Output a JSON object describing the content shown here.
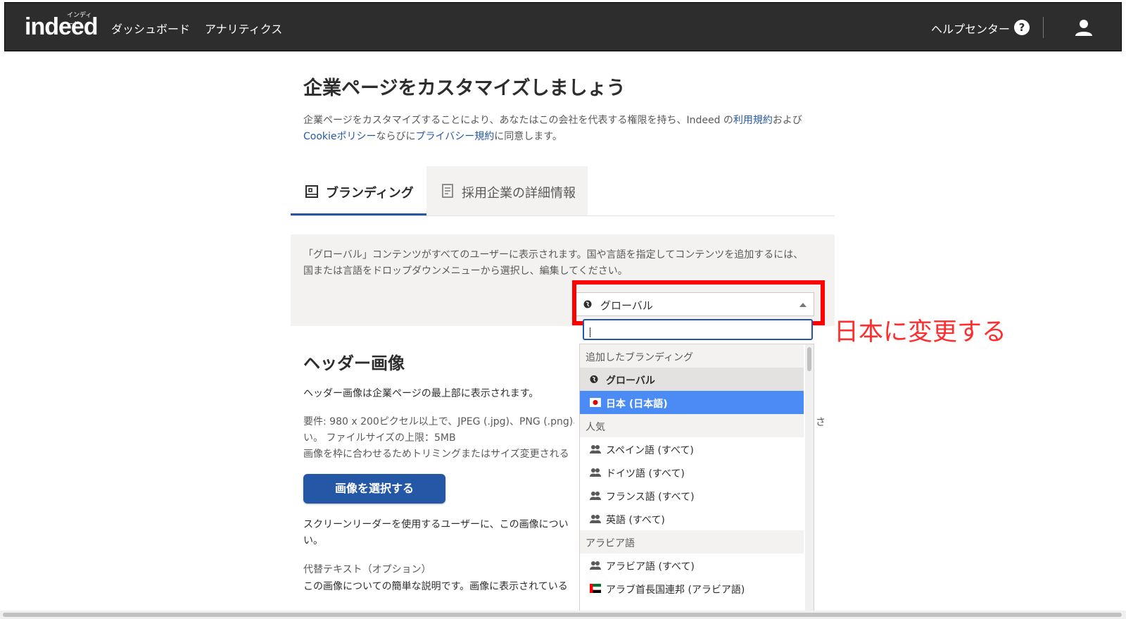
{
  "header": {
    "logo": "indeed",
    "logo_kana": "インディード",
    "nav": [
      "ダッシュボード",
      "アナリティクス"
    ],
    "help_label": "ヘルプセンター",
    "help_icon": "?"
  },
  "page": {
    "title": "企業ページをカスタマイズしましょう",
    "intro": {
      "part1": "企業ページをカスタマイズすることにより、あなたはこの会社を代表する権限を持ち、Indeed の",
      "link_terms": "利用規約",
      "part2": "および",
      "link_cookie": "Cookieポリシー",
      "part3": "ならびに",
      "link_privacy": "プライバシー規約",
      "part4": "に同意します。"
    }
  },
  "tabs": [
    {
      "label": "ブランディング",
      "active": true
    },
    {
      "label": "採用企業の詳細情報",
      "active": false
    }
  ],
  "info_text": "「グローバル」コンテンツがすべてのユーザーに表示されます。国や言語を指定してコンテンツを追加するには、国または言語をドロップダウンメニューから選択し、編集してください。",
  "select": {
    "value": "グローバル"
  },
  "annotation": "日本に変更する",
  "dropdown": {
    "group_added": "追加したブランディング",
    "opt_global": "グローバル",
    "opt_japan": "日本 (日本語)",
    "group_popular": "人気",
    "popular": [
      "スペイン語 (すべて)",
      "ドイツ語 (すべて)",
      "フランス語 (すべて)",
      "英語 (すべて)"
    ],
    "group_arabic": "アラビア語",
    "arabic": [
      "アラビア語 (すべて)",
      "アラブ首長国連邦 (アラビア語)"
    ]
  },
  "header_image": {
    "heading": "ヘッダー画像",
    "desc": "ヘッダー画像は企業ページの最上部に表示されます。",
    "req_line1": "要件: 980 x 200ピクセル以上で、JPEG (.jpg)、PNG (.png)、",
    "req_line1_tail": "さ",
    "req_line2": "い。 ファイルサイズの上限：5MB",
    "req_line3": "画像を枠に合わせるためトリミングまたはサイズ変更される",
    "button": "画像を選択する",
    "sr_line1": "スクリーンリーダーを使用するユーザーに、この画像につい",
    "sr_line2": "い。",
    "alt_label": "代替テキスト（オプション）",
    "alt_desc": "この画像についての簡単な説明です。画像に表示されている"
  },
  "colors": {
    "header_bg": "#2d2d2d",
    "accent": "#2557a7",
    "annotation": "#ff0000",
    "selected": "#4b8bf5"
  }
}
